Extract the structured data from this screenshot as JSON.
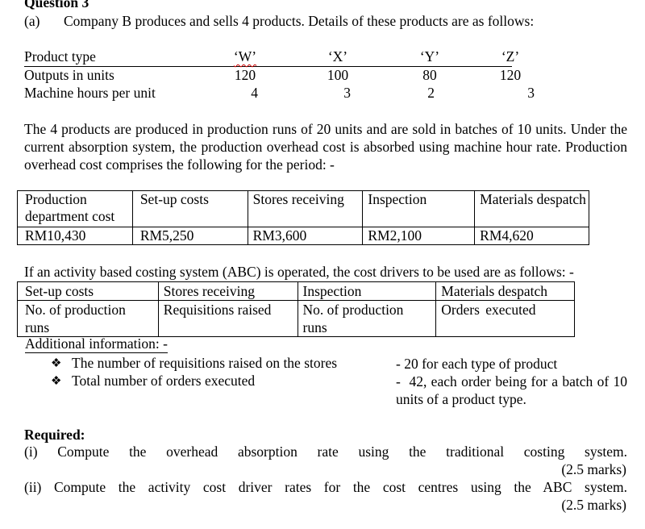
{
  "question": {
    "title": "Question 3",
    "part_label": "(a)",
    "intro": "Company B produces and sells 4 products. Details of these products are as follows:"
  },
  "product_table": {
    "header_label": "Product type",
    "products": [
      "‘W’",
      "‘X’",
      "‘Y’",
      "‘Z’"
    ],
    "rows": [
      {
        "label": "Outputs in units",
        "values": [
          "120",
          "100",
          "80",
          "120"
        ]
      },
      {
        "label": "Machine hours per unit",
        "values": [
          "4",
          "3",
          "2",
          "3"
        ]
      }
    ]
  },
  "paragraph1": "The 4 products are produced in production runs of 20 units and are sold in batches of 10 units. Under the current absorption system, the production overhead cost is absorbed using machine hour rate.  Production overhead cost comprises the following for the period: -",
  "cost_table": {
    "headers": [
      "Production department cost",
      "Set-up costs",
      "Stores receiving",
      "Inspection",
      "Materials despatch"
    ],
    "values": [
      "RM10,430",
      "RM5,250",
      "RM3,600",
      "RM2,100",
      "RM4,620"
    ]
  },
  "abc_intro": "If an activity based costing system (ABC) is operated, the cost drivers to be used are as follows: -",
  "abc_table": {
    "headers": [
      "Set-up costs",
      "Stores receiving",
      "Inspection",
      "Materials despatch"
    ],
    "drivers": [
      "No. of production runs",
      "Requisitions raised",
      "No. of production runs",
      "Orders executed"
    ]
  },
  "additional": {
    "heading": "Additional information: -",
    "bullet_icon": "❖",
    "items": [
      {
        "text": "The number of requisitions raised on the stores",
        "detail": "- 20 for each type of product"
      },
      {
        "text": "Total number of orders executed",
        "detail": "-  42, each order being for a batch of 10 units of a product type."
      }
    ]
  },
  "required": {
    "heading": "Required:",
    "items": [
      {
        "text": "(i) Compute the overhead absorption rate using the traditional costing system.",
        "marks": "(2.5 marks)"
      },
      {
        "text": "(ii) Compute the activity cost driver rates for the cost centres using the ABC system.",
        "marks": "(2.5 marks)"
      }
    ]
  }
}
